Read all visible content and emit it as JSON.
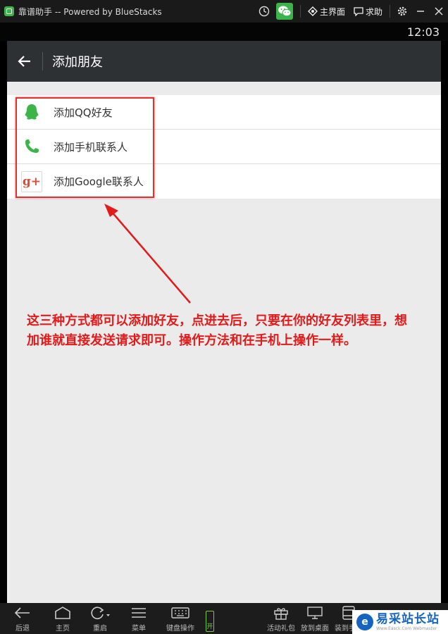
{
  "window": {
    "title": "靠谱助手 -- Powered by BlueStacks",
    "home_label": "主界面",
    "help_label": "求助"
  },
  "status_bar": {
    "time": "12:03"
  },
  "action_bar": {
    "title": "添加朋友"
  },
  "list": {
    "items": [
      {
        "label": "添加QQ好友",
        "icon": "qq-icon"
      },
      {
        "label": "添加手机联系人",
        "icon": "phone-icon"
      },
      {
        "label": "添加Google联系人",
        "icon": "google-plus-icon",
        "icon_text": "g+"
      }
    ]
  },
  "annotation": {
    "text": "这三种方式都可以添加好友，点进去后，只要在你的好友列表里，想加谁就直接发送请求即可。操作方法和在手机上操作一样。"
  },
  "bottom_bar": {
    "back": "后退",
    "home": "主页",
    "restart": "重启",
    "menu": "菜单",
    "keyboard": "键盘操作",
    "keyboard_toggle": "开",
    "gift": "活动礼包",
    "desktop": "放到桌面",
    "to_phone": "装到手机"
  },
  "watermark": {
    "logo": "e",
    "main": "易采站长站",
    "sub": "Www.Easck.Com Webmaster"
  },
  "colors": {
    "action_bar": "#2e3134",
    "annotation": "#e31a1a",
    "qq_green": "#3bb54a",
    "phone_green": "#3bb54a",
    "google_red": "#dd4b39"
  }
}
